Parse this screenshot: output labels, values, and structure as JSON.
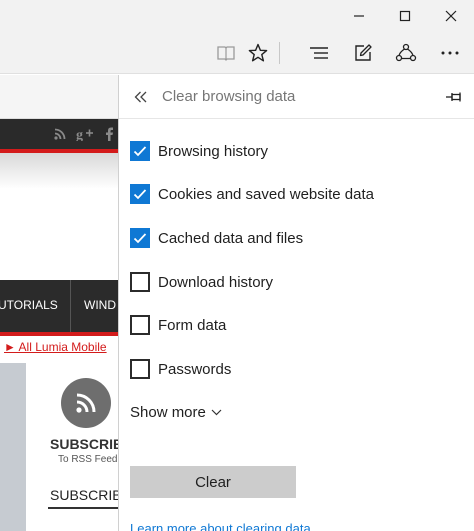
{
  "window": {
    "controls": [
      "minimize-icon",
      "maximize-icon",
      "close-icon"
    ]
  },
  "toolbar": {
    "icons": [
      "reading-view-icon",
      "favorites-star-icon",
      "hub-icon",
      "web-note-icon",
      "share-icon",
      "more-icon"
    ]
  },
  "page": {
    "social_icons": [
      "rss-icon",
      "google-plus-icon",
      "facebook-icon"
    ],
    "nav_items": [
      "UTORIALS",
      "WIND"
    ],
    "lumia_link": "► All Lumia Mobile",
    "subscribe_heading": "SUBSCRIB",
    "rss_feed": "To RSS Feed",
    "subscribe_tab": "SUBSCRIB"
  },
  "panel": {
    "title": "Clear browsing data",
    "options": [
      {
        "label": "Browsing history",
        "checked": true
      },
      {
        "label": "Cookies and saved website data",
        "checked": true
      },
      {
        "label": "Cached data and files",
        "checked": true
      },
      {
        "label": "Download history",
        "checked": false
      },
      {
        "label": "Form data",
        "checked": false
      },
      {
        "label": "Passwords",
        "checked": false
      }
    ],
    "show_more": "Show more",
    "clear_label": "Clear",
    "bottom_link": "Learn more about clearing data"
  },
  "colors": {
    "accent": "#0f78d4",
    "checkbox_border": "#2b2b2b",
    "button_bg": "#cccccc",
    "site_red": "#d31b1b"
  }
}
